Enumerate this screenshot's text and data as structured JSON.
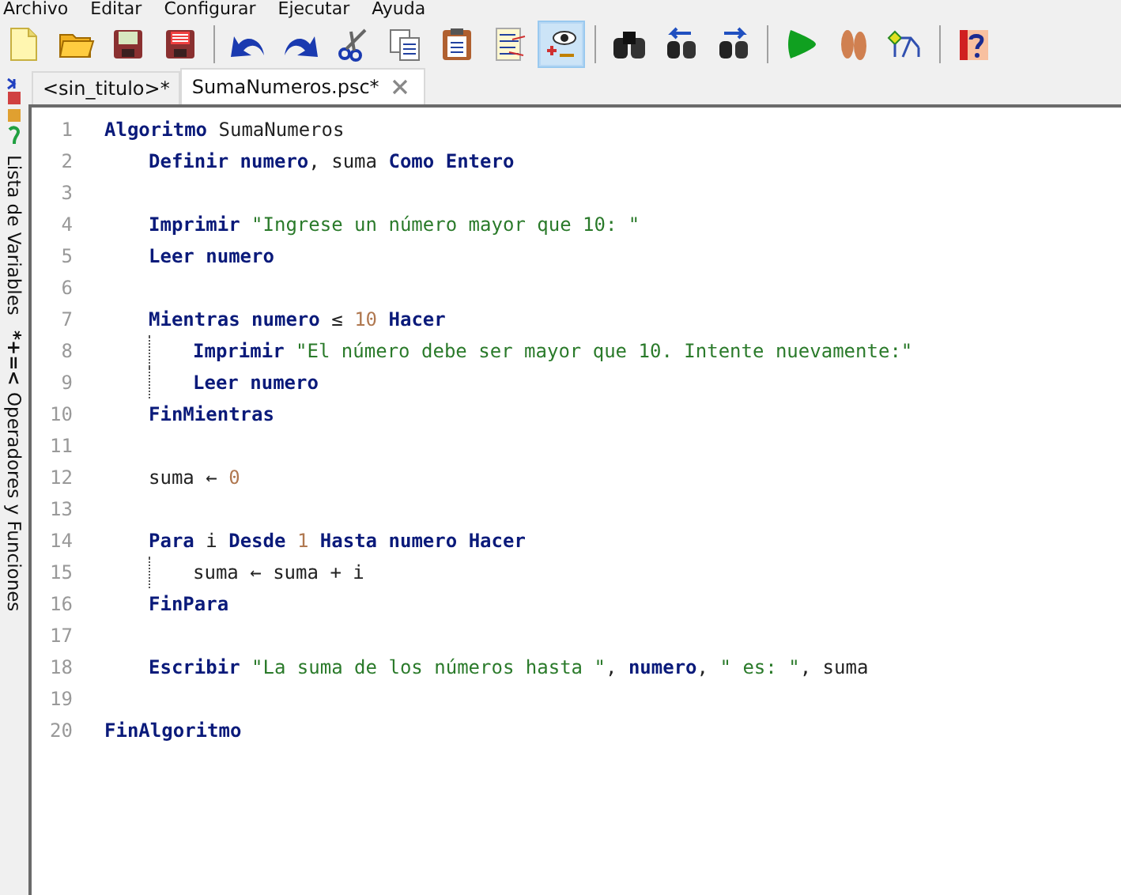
{
  "menu": [
    "Archivo",
    "Editar",
    "Configurar",
    "Ejecutar",
    "Ayuda"
  ],
  "toolbar": [
    {
      "kind": "new",
      "selected": false
    },
    {
      "kind": "open",
      "selected": false
    },
    {
      "kind": "save",
      "selected": false
    },
    {
      "kind": "save-as",
      "selected": false
    },
    {
      "kind": "separator"
    },
    {
      "kind": "undo",
      "selected": false
    },
    {
      "kind": "redo",
      "selected": false
    },
    {
      "kind": "cut",
      "selected": false
    },
    {
      "kind": "copy",
      "selected": false
    },
    {
      "kind": "paste",
      "selected": false
    },
    {
      "kind": "edit",
      "selected": false
    },
    {
      "kind": "watch",
      "selected": true
    },
    {
      "kind": "separator"
    },
    {
      "kind": "find",
      "selected": false
    },
    {
      "kind": "find-prev",
      "selected": false
    },
    {
      "kind": "find-next",
      "selected": false
    },
    {
      "kind": "separator"
    },
    {
      "kind": "run",
      "selected": false
    },
    {
      "kind": "step",
      "selected": false
    },
    {
      "kind": "flowchart",
      "selected": false
    },
    {
      "kind": "separator"
    },
    {
      "kind": "help",
      "selected": false
    }
  ],
  "side_panels": [
    {
      "kind": "variables",
      "label": "Lista de Variables"
    },
    {
      "kind": "operators",
      "symbol": "*+=<",
      "label": "Operadores y Funciones"
    }
  ],
  "tabs": [
    {
      "label": "<sin_titulo>*",
      "selected": false
    },
    {
      "label": "SumaNumeros.psc*",
      "selected": true
    }
  ],
  "code": [
    {
      "number": "1",
      "tokens": [
        {
          "kind": "kw",
          "text": "Algoritmo"
        },
        {
          "kind": "id",
          "text": " SumaNumeros"
        }
      ],
      "children": [
        {
          "number": "2",
          "tokens": [
            {
              "kind": "kw",
              "text": "Definir numero"
            },
            {
              "kind": "id",
              "text": ", suma "
            },
            {
              "kind": "kw",
              "text": "Como Entero"
            }
          ]
        },
        {
          "number": "3"
        },
        {
          "number": "4",
          "tokens": [
            {
              "kind": "kw",
              "text": "Imprimir"
            },
            {
              "kind": "str",
              "text": " \"Ingrese un número mayor que 10: \""
            }
          ]
        },
        {
          "number": "5",
          "tokens": [
            {
              "kind": "kw",
              "text": "Leer numero"
            }
          ]
        },
        {
          "number": "6"
        },
        {
          "number": "7",
          "tokens": [
            {
              "kind": "kw",
              "text": "Mientras numero"
            },
            {
              "kind": "id",
              "text": " ≤ "
            },
            {
              "kind": "num",
              "text": "10"
            },
            {
              "kind": "kw",
              "text": " Hacer"
            }
          ],
          "children": [
            {
              "number": "8",
              "tokens": [
                {
                  "kind": "kw",
                  "text": "Imprimir"
                },
                {
                  "kind": "str",
                  "text": " \"El número debe ser mayor que 10. Intente nuevamente:\""
                }
              ]
            },
            {
              "number": "9",
              "tokens": [
                {
                  "kind": "kw",
                  "text": "Leer numero"
                }
              ]
            }
          ]
        },
        {
          "number": "10",
          "tokens": [
            {
              "kind": "kw",
              "text": "FinMientras"
            }
          ]
        },
        {
          "number": "11"
        },
        {
          "number": "12",
          "tokens": [
            {
              "kind": "id",
              "text": "suma ← "
            },
            {
              "kind": "num",
              "text": "0"
            }
          ]
        },
        {
          "number": "13"
        },
        {
          "number": "14",
          "tokens": [
            {
              "kind": "kw",
              "text": "Para"
            },
            {
              "kind": "id",
              "text": " i "
            },
            {
              "kind": "kw",
              "text": "Desde"
            },
            {
              "kind": "num",
              "text": " 1 "
            },
            {
              "kind": "kw",
              "text": "Hasta numero Hacer"
            }
          ],
          "children": [
            {
              "number": "15",
              "tokens": [
                {
                  "kind": "id",
                  "text": "suma ← suma + i"
                }
              ]
            }
          ]
        },
        {
          "number": "16",
          "tokens": [
            {
              "kind": "kw",
              "text": "FinPara"
            }
          ]
        },
        {
          "number": "17"
        },
        {
          "number": "18",
          "tokens": [
            {
              "kind": "kw",
              "text": "Escribir"
            },
            {
              "kind": "str",
              "text": " \"La suma de los números hasta \""
            },
            {
              "kind": "id",
              "text": ", "
            },
            {
              "kind": "kw",
              "text": "numero"
            },
            {
              "kind": "id",
              "text": ", "
            },
            {
              "kind": "str",
              "text": "\" es: \""
            },
            {
              "kind": "id",
              "text": ", suma"
            }
          ]
        },
        {
          "number": "19"
        }
      ]
    },
    {
      "number": "20",
      "tokens": [
        {
          "kind": "kw",
          "text": "FinAlgoritmo"
        }
      ]
    }
  ]
}
